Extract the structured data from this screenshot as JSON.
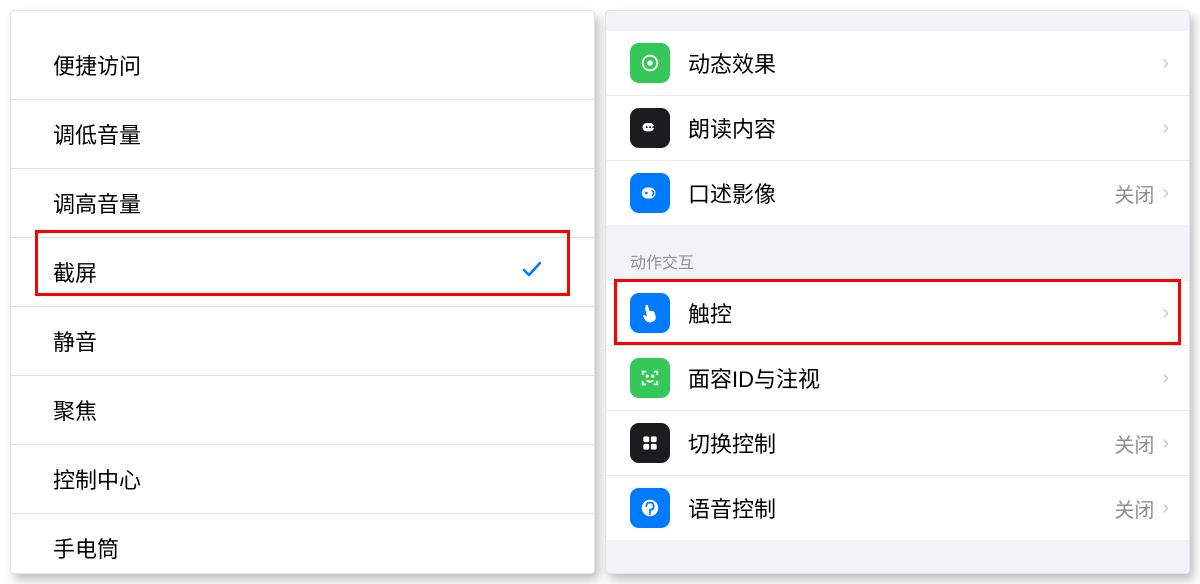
{
  "left": {
    "items": [
      {
        "label": "便捷访问",
        "selected": false
      },
      {
        "label": "调低音量",
        "selected": false
      },
      {
        "label": "调高音量",
        "selected": false
      },
      {
        "label": "截屏",
        "selected": true
      },
      {
        "label": "静音",
        "selected": false
      },
      {
        "label": "聚焦",
        "selected": false
      },
      {
        "label": "控制中心",
        "selected": false
      },
      {
        "label": "手电筒",
        "selected": false
      }
    ]
  },
  "right": {
    "group1": [
      {
        "icon": "motion",
        "color": "#34c759",
        "label": "动态效果",
        "value": ""
      },
      {
        "icon": "speak",
        "color": "#1c1c1e",
        "label": "朗读内容",
        "value": ""
      },
      {
        "icon": "describe",
        "color": "#007aff",
        "label": "口述影像",
        "value": "关闭"
      }
    ],
    "group2_header": "动作交互",
    "group2": [
      {
        "icon": "touch",
        "color": "#007aff",
        "label": "触控",
        "value": ""
      },
      {
        "icon": "faceid",
        "color": "#34c759",
        "label": "面容ID与注视",
        "value": ""
      },
      {
        "icon": "switch",
        "color": "#1c1c1e",
        "label": "切换控制",
        "value": "关闭"
      },
      {
        "icon": "voice",
        "color": "#007aff",
        "label": "语音控制",
        "value": "关闭"
      }
    ]
  }
}
